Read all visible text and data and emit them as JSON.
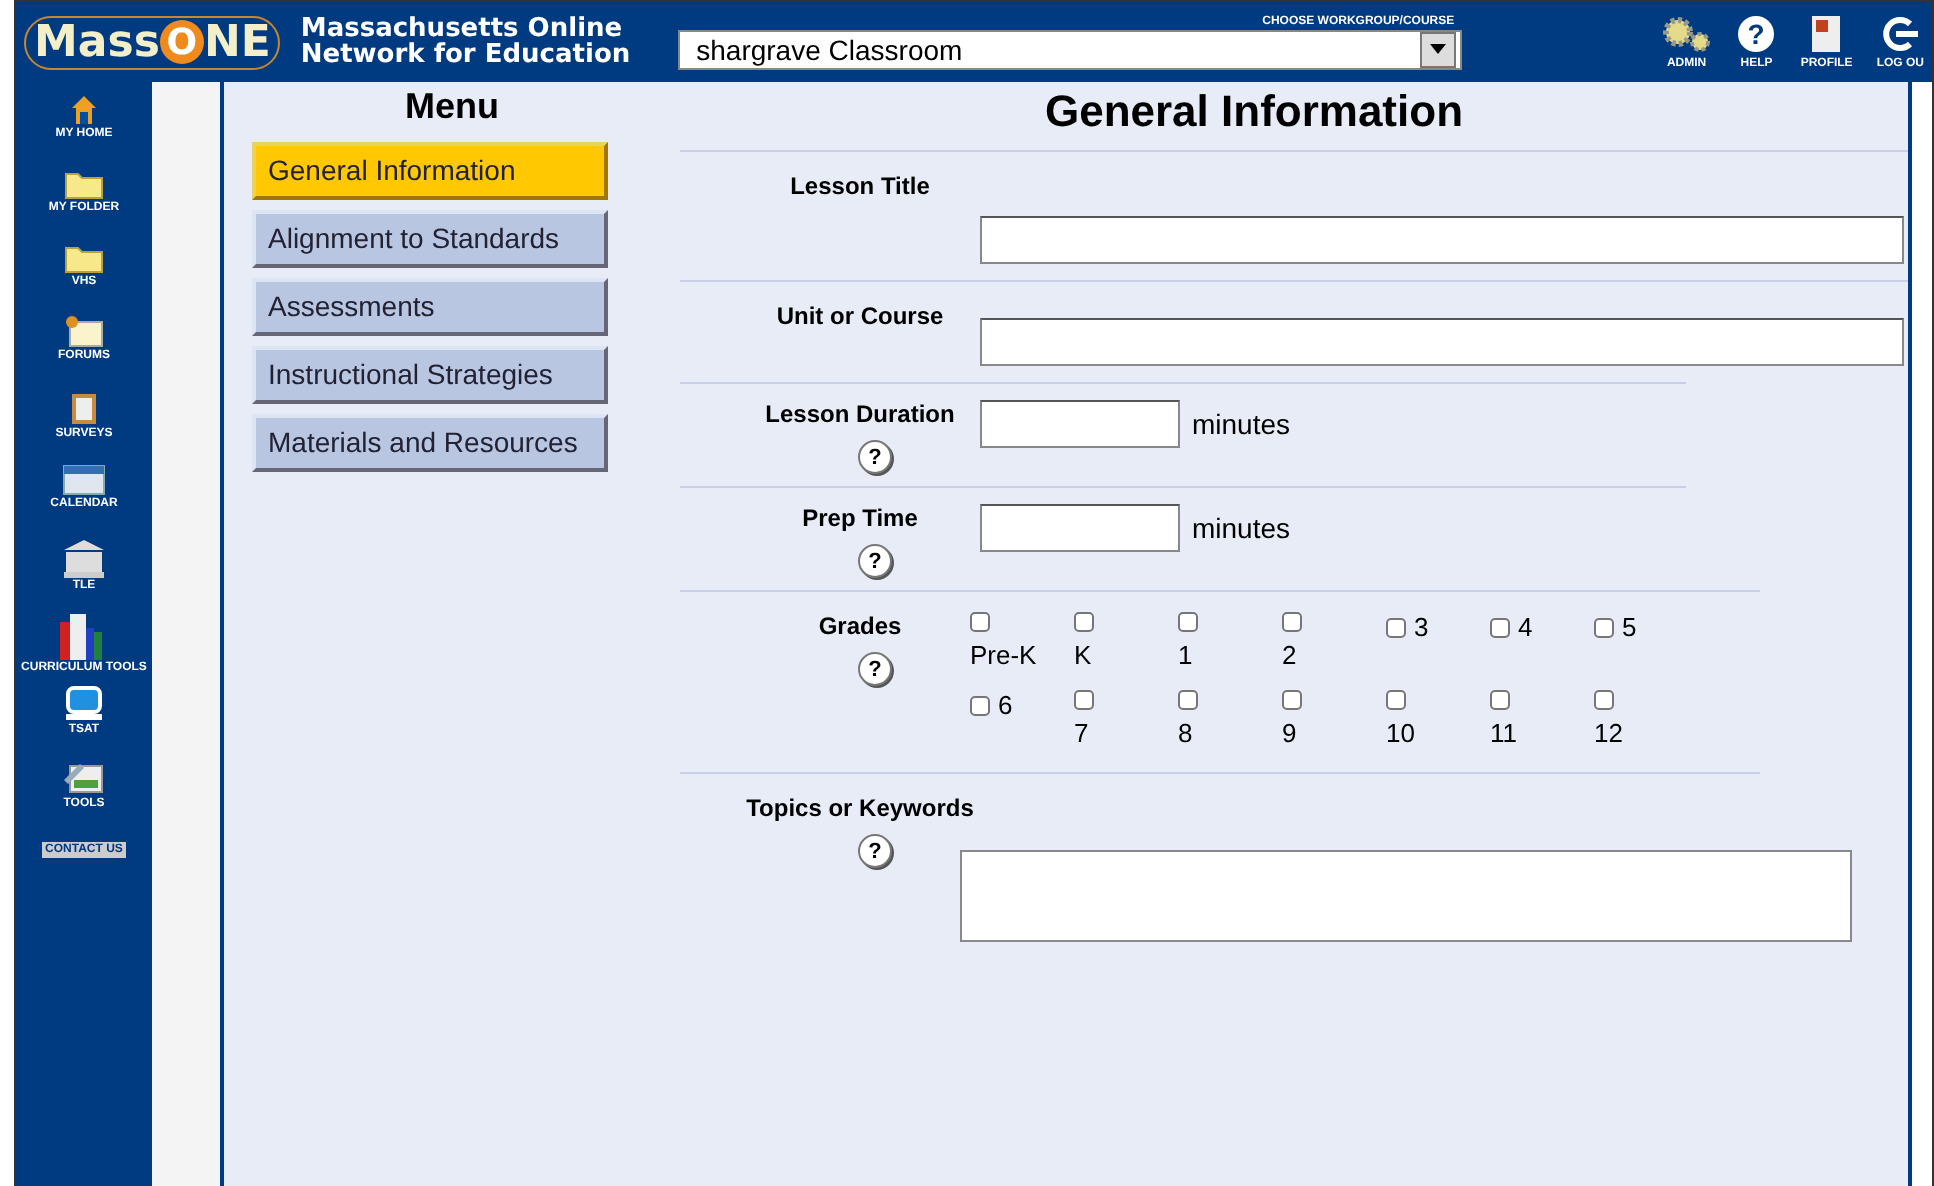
{
  "header": {
    "logo_left": "Mass",
    "logo_mid": "O",
    "logo_right": "NE",
    "tagline_1": "Massachusetts Online",
    "tagline_2": "Network for Education",
    "course_label": "CHOOSE WORKGROUP/COURSE",
    "course_value": "shargrave Classroom",
    "tools": [
      {
        "label": "ADMIN",
        "kind": "gear"
      },
      {
        "label": "HELP",
        "kind": "help",
        "glyph": "?"
      },
      {
        "label": "PROFILE",
        "kind": "doc"
      },
      {
        "label": "LOG OU",
        "kind": "logout"
      }
    ]
  },
  "sidebar": [
    {
      "label": "MY HOME",
      "kind": "home"
    },
    {
      "label": "MY FOLDER",
      "kind": "folder"
    },
    {
      "label": "VHS",
      "kind": "folder"
    },
    {
      "label": "FORUMS",
      "kind": "note"
    },
    {
      "label": "SURVEYS",
      "kind": "clipboard"
    },
    {
      "label": "CALENDAR",
      "kind": "calendar"
    },
    {
      "label": "TLE",
      "kind": "building"
    },
    {
      "label": "CURRICULUM TOOLS",
      "kind": "books"
    },
    {
      "label": "TSAT",
      "kind": "monitor"
    },
    {
      "label": "TOOLS",
      "kind": "picture"
    },
    {
      "label": "CONTACT US",
      "kind": "contact"
    }
  ],
  "menu": {
    "title": "Menu",
    "items": [
      {
        "label": "General Information",
        "selected": true
      },
      {
        "label": "Alignment to Standards",
        "selected": false
      },
      {
        "label": "Assessments",
        "selected": false
      },
      {
        "label": "Instructional Strategies",
        "selected": false
      },
      {
        "label": "Materials and Resources",
        "selected": false
      }
    ]
  },
  "form": {
    "title": "General Information",
    "rows": [
      {
        "kind": "wide",
        "label": "Lesson Title"
      },
      {
        "kind": "wide",
        "label": "Unit or Course"
      },
      {
        "kind": "short",
        "label": "Lesson Duration",
        "help": "?",
        "unit": "minutes"
      },
      {
        "kind": "short",
        "label": "Prep Time",
        "help": "?",
        "unit": "minutes"
      },
      {
        "kind": "grades",
        "label": "Grades",
        "help": "?",
        "grades": [
          {
            "label": "Pre-K",
            "kind": "below",
            "checked": false
          },
          {
            "label": "K",
            "kind": "below",
            "checked": false
          },
          {
            "label": "1",
            "kind": "below",
            "checked": false
          },
          {
            "label": "2",
            "kind": "below",
            "checked": false
          },
          {
            "label": "3",
            "kind": "beside",
            "checked": false
          },
          {
            "label": "4",
            "kind": "beside",
            "checked": false
          },
          {
            "label": "5",
            "kind": "beside",
            "checked": false
          },
          {
            "label": "6",
            "kind": "beside",
            "checked": false
          },
          {
            "label": "7",
            "kind": "below",
            "checked": false
          },
          {
            "label": "8",
            "kind": "below",
            "checked": false
          },
          {
            "label": "9",
            "kind": "below",
            "checked": false
          },
          {
            "label": "10",
            "kind": "below",
            "checked": false
          },
          {
            "label": "11",
            "kind": "below",
            "checked": false
          },
          {
            "label": "12",
            "kind": "below",
            "checked": false
          }
        ]
      },
      {
        "kind": "area",
        "label": "Topics or Keywords",
        "help": "?"
      }
    ]
  }
}
